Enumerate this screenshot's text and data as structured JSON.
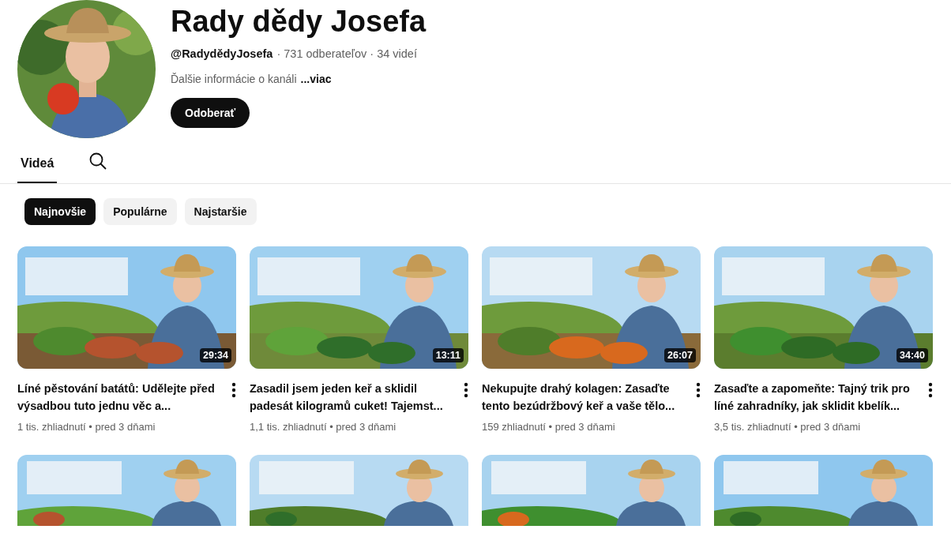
{
  "channel": {
    "name": "Rady dědy Josefa",
    "handle": "@RadydědyJosefa",
    "stats": "· 731 odberateľov · 34 videí",
    "description": "Ďalšie informácie o kanáli",
    "more_link": "...viac",
    "subscribe": "Odoberať"
  },
  "tabs": [
    {
      "label": "Videá",
      "selected": true
    }
  ],
  "chips": [
    {
      "label": "Najnovšie",
      "selected": true
    },
    {
      "label": "Populárne",
      "selected": false
    },
    {
      "label": "Najstaršie",
      "selected": false
    }
  ],
  "videos": [
    {
      "title": "Líné pěstování batátů: Udělejte před výsadbou tuto jednu věc a...",
      "meta": "1 tis. zhliadnutí • pred 3 dňami",
      "duration": "29:34"
    },
    {
      "title": "Zasadil jsem jeden keř a sklidil padesát kilogramů cuket! Tajemst...",
      "meta": "1,1 tis. zhliadnutí • pred 3 dňami",
      "duration": "13:11"
    },
    {
      "title": "Nekupujte drahý kolagen: Zasaďte tento bezúdržbový keř a vaše tělo...",
      "meta": "159 zhliadnutí • pred 3 dňami",
      "duration": "26:07"
    },
    {
      "title": "Zasaďte a zapomeňte: Tajný trik pro líné zahradníky, jak sklidit kbelík...",
      "meta": "3,5 tis. zhliadnutí • pred 3 dňami",
      "duration": "34:40"
    }
  ]
}
